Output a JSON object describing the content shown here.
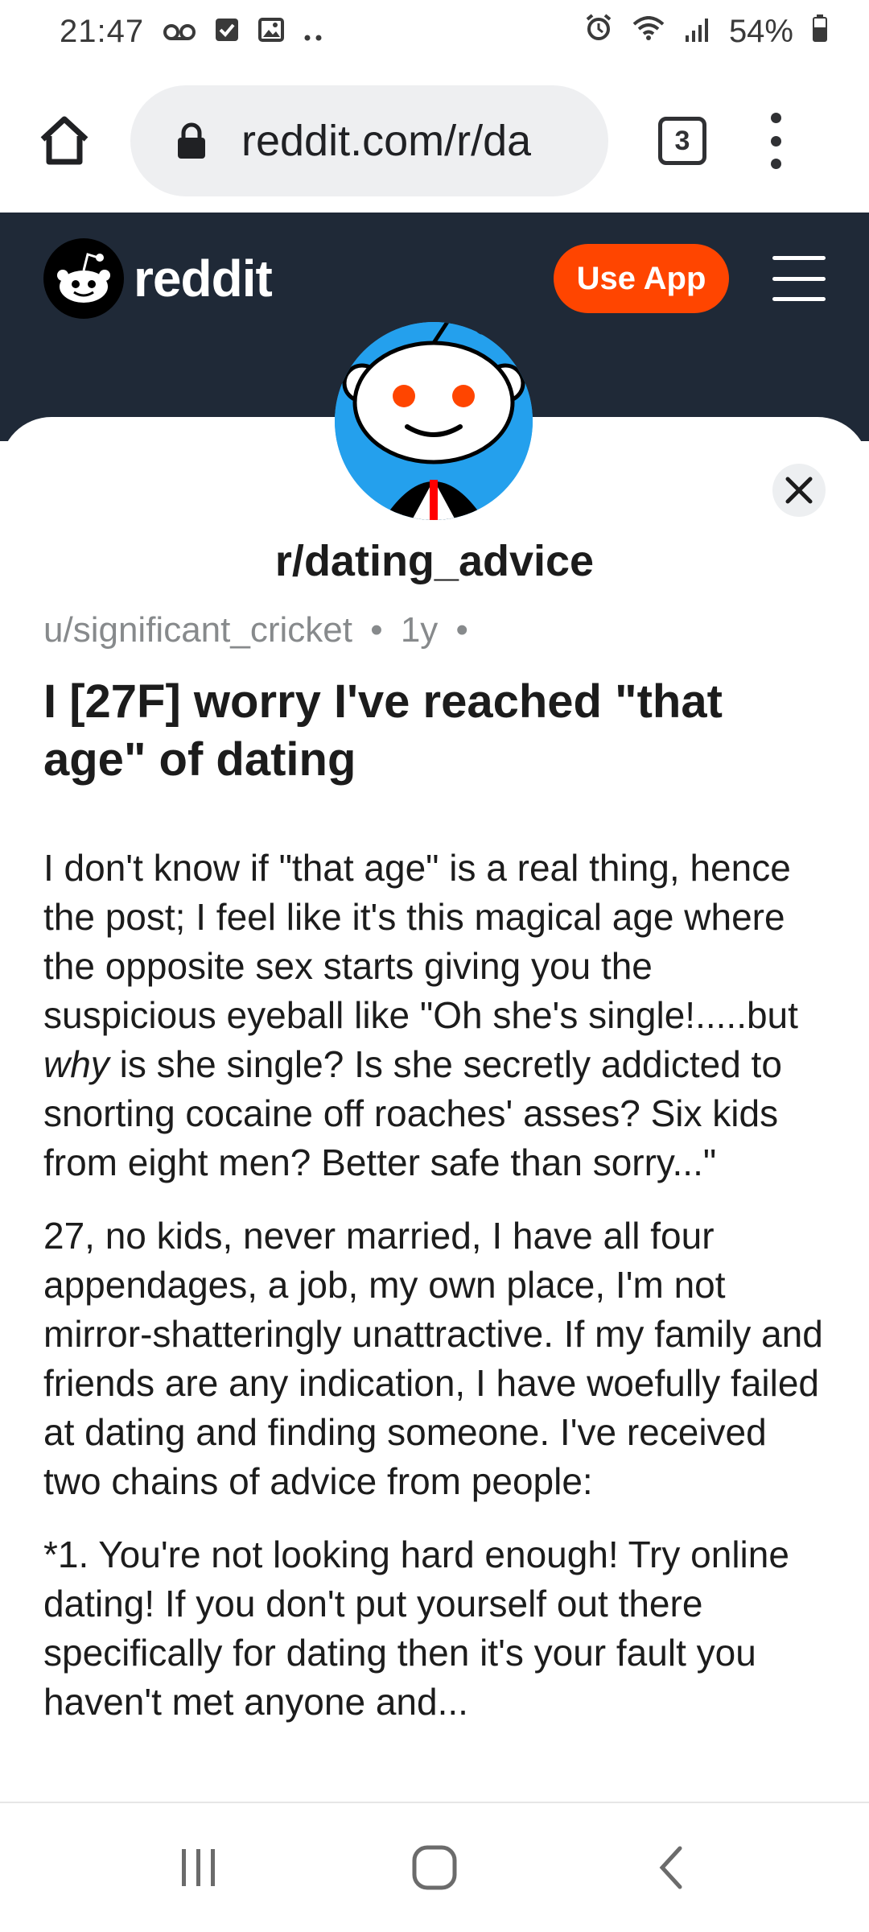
{
  "status_bar": {
    "time": "21:47",
    "battery": "54%"
  },
  "browser": {
    "url": "reddit.com/r/da",
    "tab_count": "3"
  },
  "header": {
    "wordmark": "reddit",
    "use_app_label": "Use App",
    "colors": {
      "header_bg": "#1f2937",
      "accent": "#ff4500"
    }
  },
  "post": {
    "subreddit": "r/dating_advice",
    "author": "u/significant_cricket",
    "age": "1y",
    "separator": "•",
    "title": "I [27F] worry I've reached \"that age\" of dating",
    "body": {
      "p1_before": "I don't know if \"that age\" is a real thing, hence the post; I feel like it's this magical age where the opposite sex starts giving you the suspicious eyeball like \"Oh she's single!.....but ",
      "p1_emph": "why",
      "p1_after": " is she single? Is she secretly addicted to snorting cocaine off roaches' asses? Six kids from eight men? Better safe than sorry...\"",
      "p2": "27, no kids, never married, I have all four appendages, a job, my own place, I'm not mirror-shatteringly unattractive. If my family and friends are any indication, I have woefully failed at dating and finding someone. I've received two chains of advice from people:",
      "p3": "*1. You're not looking hard enough! Try online dating! If you don't put yourself out there specifically for dating then it's your fault you haven't met anyone and..."
    }
  },
  "icons": {
    "home": "home-icon",
    "lock": "lock-icon",
    "menu": "more-vert-icon",
    "close": "close-icon",
    "hamburger": "hamburger-icon"
  }
}
